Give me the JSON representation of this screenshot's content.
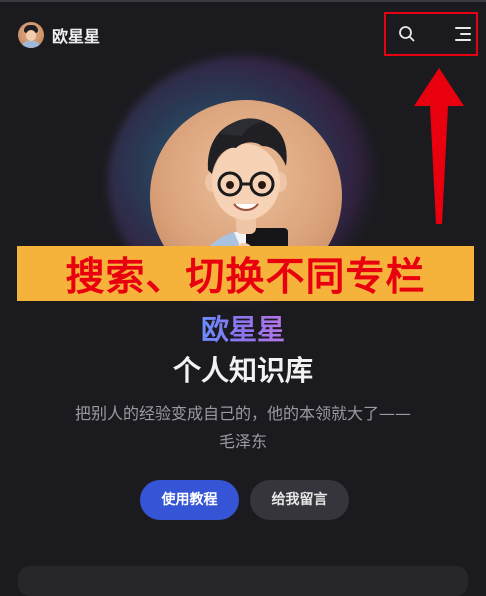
{
  "navbar": {
    "site_name": "欧星星",
    "search_icon": "search-icon",
    "menu_icon": "menu-icon"
  },
  "annotation": {
    "text": "搜索、切换不同专栏",
    "text_color": "#e8000f",
    "background_color": "#f6b33c"
  },
  "hero": {
    "name": "欧星星",
    "subtitle": "个人知识库",
    "tagline_line1": "把别人的经验变成自己的，他的本领就大了——",
    "tagline_line2": "毛泽东",
    "buttons": {
      "primary_label": "使用教程",
      "secondary_label": "给我留言"
    }
  },
  "colors": {
    "page_background": "#1b1b1f",
    "primary_button": "#3555d6",
    "secondary_button": "#35353b",
    "highlight_box": "#e60012"
  }
}
